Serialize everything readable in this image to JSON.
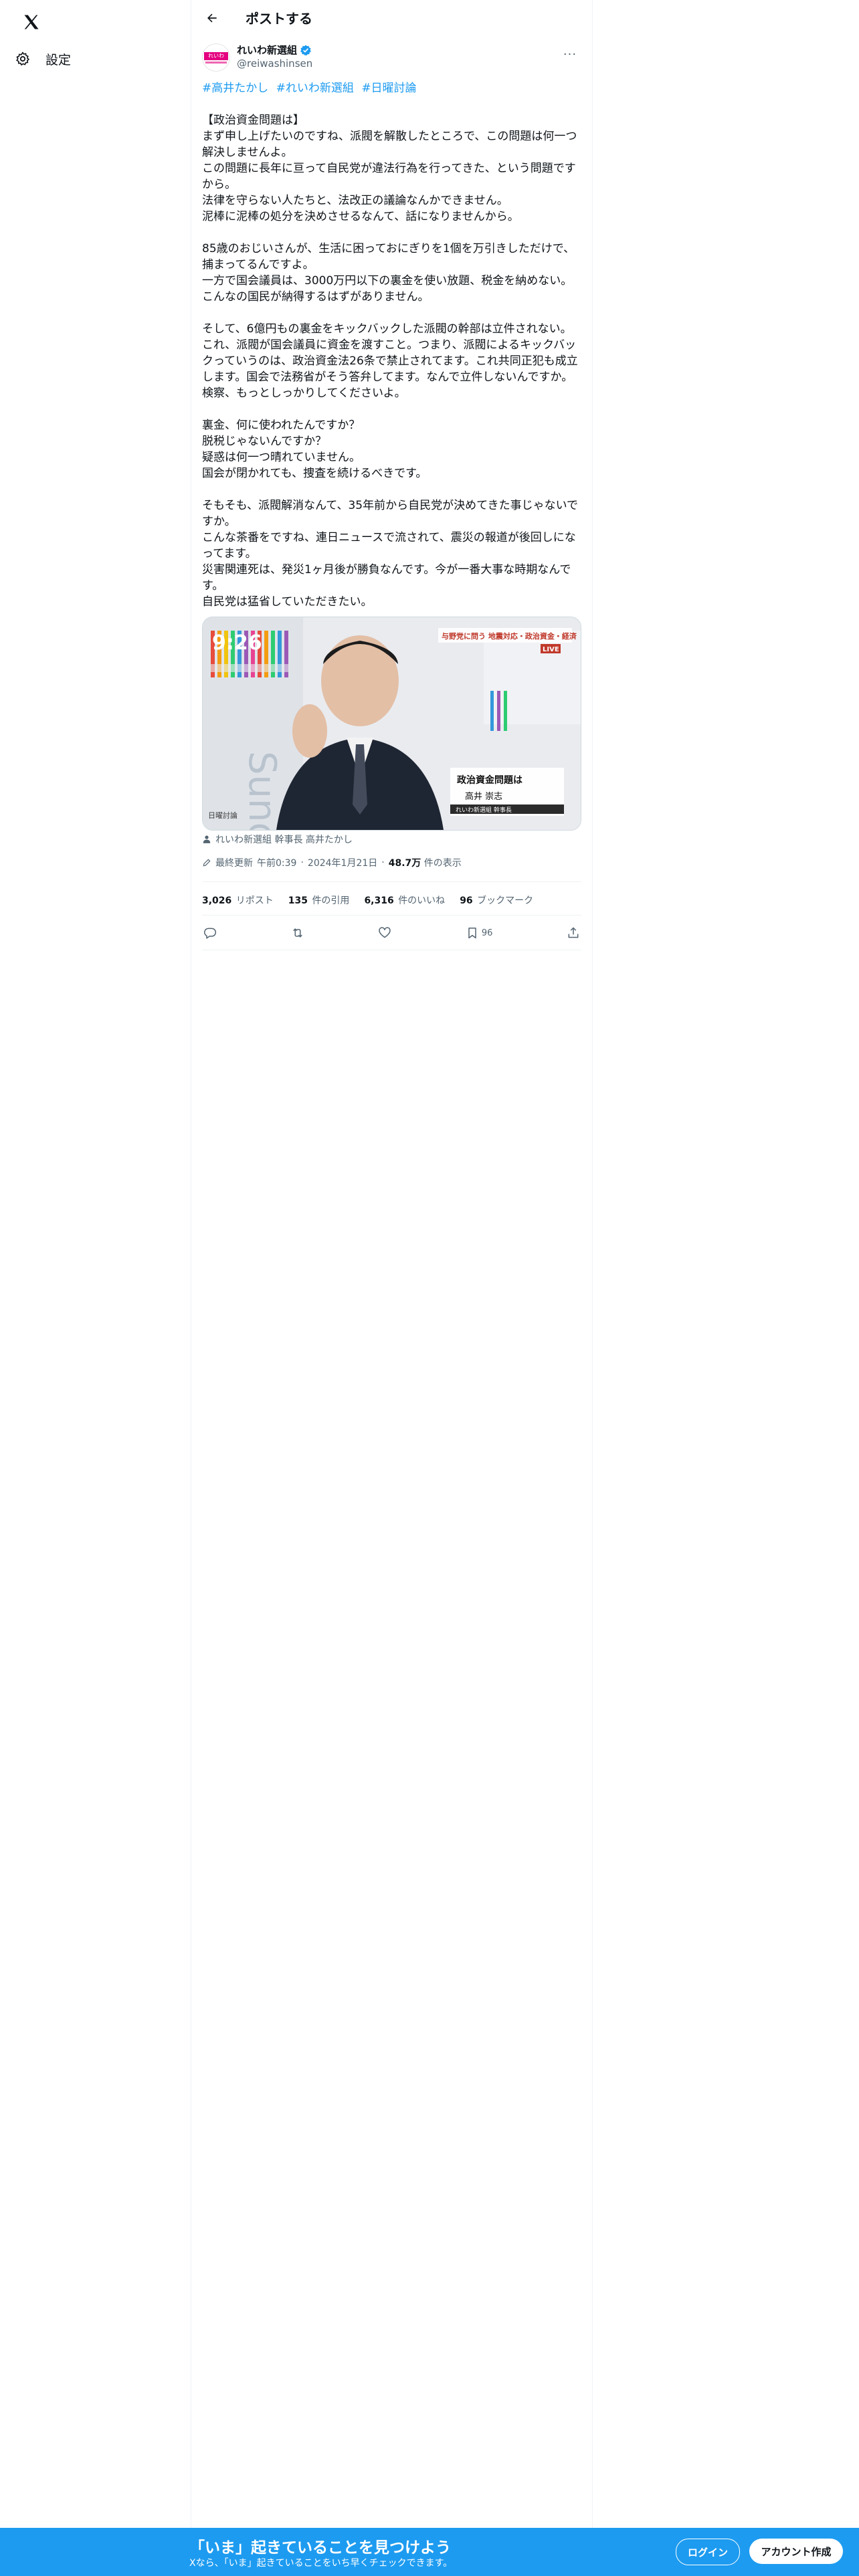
{
  "nav": {
    "settings_label": "設定"
  },
  "header": {
    "title": "ポストする"
  },
  "author": {
    "name": "れいわ新選組",
    "handle": "@reiwashinsen",
    "avatar_text": "れいわ"
  },
  "post": {
    "hashtags": [
      "#高井たかし",
      "#れいわ新選組",
      "#日曜討論"
    ],
    "lines": [
      "【政治資金問題は】",
      "まず申し上げたいのですね、派閥を解散したところで、この問題は何一つ解決しませんよ。",
      "この問題に長年に亘って自民党が違法行為を行ってきた、という問題ですから。",
      "法律を守らない人たちと、法改正の議論なんかできません。",
      "泥棒に泥棒の処分を決めさせるなんて、話になりませんから。",
      "",
      "85歳のおじいさんが、生活に困っておにぎりを1個を万引きしただけで、捕まってるんですよ。",
      "一方で国会議員は、3000万円以下の裏金を使い放題、税金を納めない。こんなの国民が納得するはずがありません。",
      "",
      "そして、6億円もの裏金をキックバックした派閥の幹部は立件されない。",
      "これ、派閥が国会議員に資金を渡すこと。つまり、派閥によるキックバックっていうのは、政治資金法26条で禁止されてます。これ共同正犯も成立します。国会で法務省がそう答弁してます。なんで立件しないんですか。",
      "検察、もっとしっかりしてくださいよ。",
      "",
      "裏金、何に使われたんですか？",
      "脱税じゃないんですか？",
      "疑惑は何一つ晴れていません。",
      "国会が閉かれても、捜査を続けるべきです。",
      "",
      "そもそも、派閥解消なんて、35年前から自民党が決めてきた事じゃないですか。",
      "こんな茶番をですね、連日ニュースで流されて、震災の報道が後回しになってます。",
      "災害関連死は、発災1ヶ月後が勝負なんです。今が一番大事な時期なんです。",
      "自民党は猛省していただきたい。"
    ],
    "image": {
      "clock": "9:26",
      "banner": "与野党に問う 地震対応・政治資金・経済",
      "live": "LIVE",
      "caption_title": "政治資金問題は",
      "caption_name": "高井 崇志",
      "caption_role": "れいわ新選組 幹事長",
      "side_bg_text": "Sunday Debate",
      "corner_label": "日曜討論"
    },
    "credit": "れいわ新選組 幹事長 高井たかし",
    "meta": {
      "prefix": "最終更新",
      "time": "午前0:39",
      "date": "2024年1月21日",
      "dot": "·",
      "views": "48.7万",
      "views_suffix": "件の表示"
    },
    "stats": {
      "reposts": "3,026",
      "reposts_label": "リポスト",
      "quotes": "135",
      "quotes_label": "件の引用",
      "likes": "6,316",
      "likes_label": "件のいいね",
      "bookmarks": "96",
      "bookmarks_label": "ブックマーク"
    },
    "bookmark_count": "96"
  },
  "bottom_bar": {
    "title": "「いま」起きていることを見つけよう",
    "subtitle": "Xなら、「いま」起きていることをいち早くチェックできます。",
    "login": "ログイン",
    "signup": "アカウント作成"
  },
  "colors": {
    "accent": "#1d9bf0",
    "brand": "#e4007f",
    "text": "#0f1419",
    "muted": "#536471"
  }
}
